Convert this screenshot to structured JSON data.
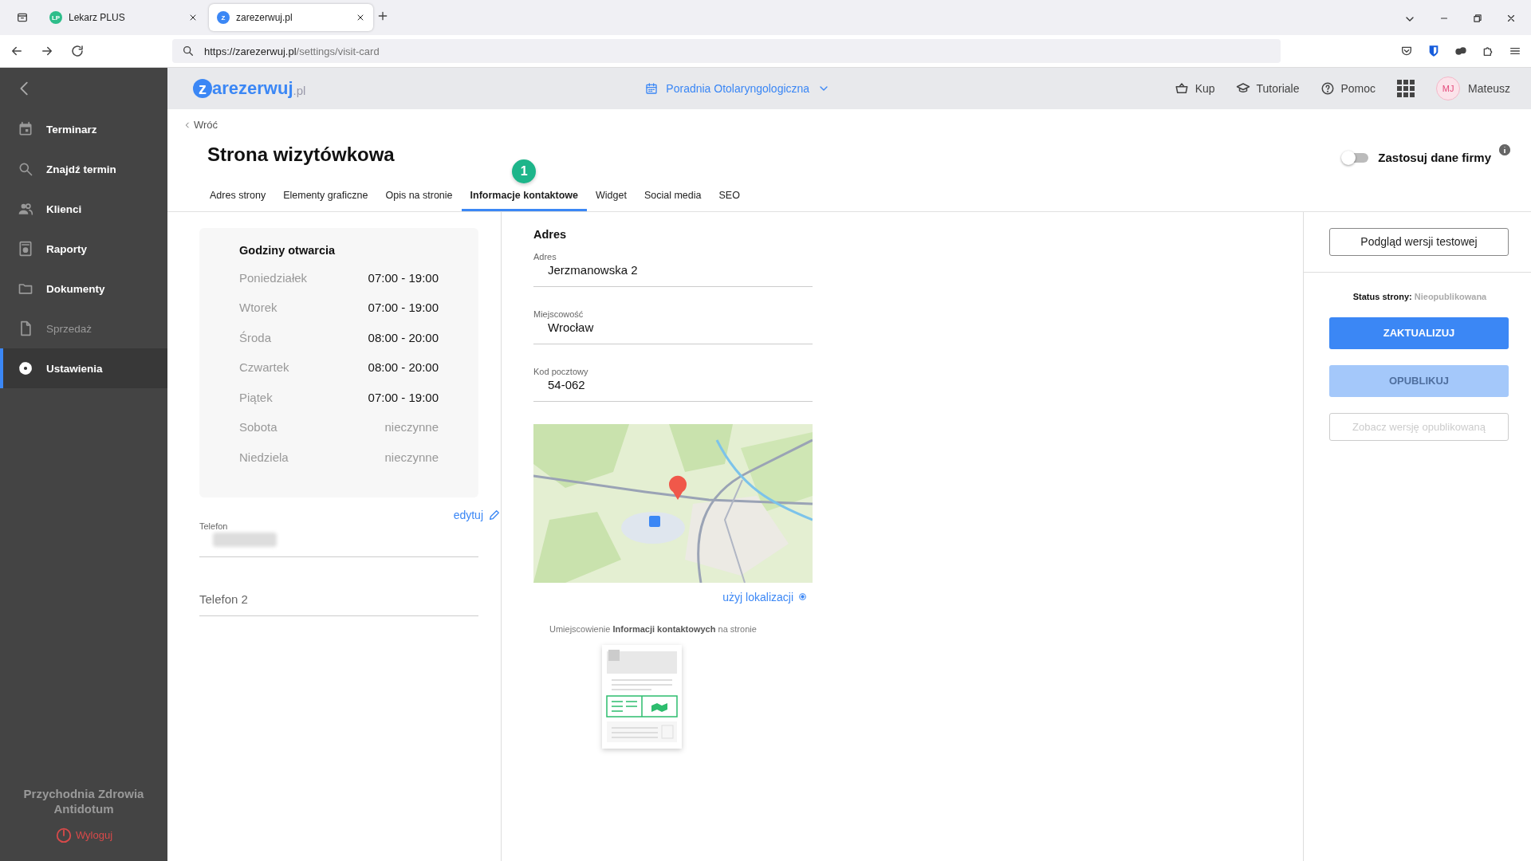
{
  "browser": {
    "tabs": [
      {
        "icon": "LP",
        "title": "Lekarz PLUS",
        "selected": false
      },
      {
        "icon": "Z",
        "title": "zarezerwuj.pl",
        "selected": true
      }
    ],
    "url_host": "https://zarezerwuj.pl",
    "url_path": "/settings/visit-card"
  },
  "header": {
    "logo": {
      "mark": "z",
      "name": "arezerwuj",
      "suffix": ".pl"
    },
    "clinic": "Poradnia Otolaryngologiczna",
    "links": [
      {
        "kind": "basket",
        "label": "Kup"
      },
      {
        "kind": "cap",
        "label": "Tutoriale"
      },
      {
        "kind": "help",
        "label": "Pomoc"
      }
    ],
    "user": {
      "initials": "MJ",
      "name": "Mateusz"
    }
  },
  "sidebar": {
    "items": [
      {
        "kind": "calendar",
        "label": "Terminarz",
        "selected": false,
        "disabled": false
      },
      {
        "kind": "search",
        "label": "Znajdź termin",
        "selected": false,
        "disabled": false
      },
      {
        "kind": "people",
        "label": "Klienci",
        "selected": false,
        "disabled": false
      },
      {
        "kind": "report",
        "label": "Raporty",
        "selected": false,
        "disabled": false
      },
      {
        "kind": "folder",
        "label": "Dokumenty",
        "selected": false,
        "disabled": false
      },
      {
        "kind": "file",
        "label": "Sprzedaż",
        "selected": false,
        "disabled": true
      },
      {
        "kind": "gear",
        "label": "Ustawienia",
        "selected": true,
        "disabled": false
      }
    ],
    "company": "Przychodnia Zdrowia Antidotum",
    "logout": "Wyloguj"
  },
  "page": {
    "back": "Wróć",
    "title": "Strona wizytówkowa",
    "toggle": {
      "label": "Zastosuj dane firmy",
      "on": false
    },
    "tabs": [
      {
        "label": "Adres strony",
        "selected": false
      },
      {
        "label": "Elementy graficzne",
        "selected": false
      },
      {
        "label": "Opis na stronie",
        "selected": false
      },
      {
        "label": "Informacje kontaktowe",
        "selected": true,
        "badge": "1"
      },
      {
        "label": "Widget",
        "selected": false
      },
      {
        "label": "Social media",
        "selected": false
      },
      {
        "label": "SEO",
        "selected": false
      }
    ]
  },
  "hours": {
    "title": "Godziny otwarcia",
    "rows": [
      {
        "day": "Poniedziałek",
        "hours": "07:00 - 19:00",
        "closed": false
      },
      {
        "day": "Wtorek",
        "hours": "07:00 - 19:00",
        "closed": false
      },
      {
        "day": "Środa",
        "hours": "08:00 - 20:00",
        "closed": false
      },
      {
        "day": "Czwartek",
        "hours": "08:00 - 20:00",
        "closed": false
      },
      {
        "day": "Piątek",
        "hours": "07:00 - 19:00",
        "closed": false
      },
      {
        "day": "Sobota",
        "hours": "nieczynne",
        "closed": true
      },
      {
        "day": "Niedziela",
        "hours": "nieczynne",
        "closed": true
      }
    ],
    "edit": "edytuj"
  },
  "phones": {
    "phone_label": "Telefon",
    "phone2_placeholder": "Telefon 2"
  },
  "address": {
    "title": "Adres",
    "fields": [
      {
        "label": "Adres",
        "value": "Jerzmanowska 2"
      },
      {
        "label": "Miejscowość",
        "value": "Wrocław"
      },
      {
        "label": "Kod pocztowy",
        "value": "54-062"
      }
    ],
    "use_location": "użyj lokalizacji",
    "placement_note": "Umiejscowienie **Informacji kontaktowych** na stronie"
  },
  "actions": {
    "preview": "Podgląd wersji testowej",
    "status_label": "Status strony:",
    "status_value": "Nieopublikowana",
    "buttons": [
      {
        "kind": "primary",
        "label": "ZAKTUALIZUJ",
        "disabled": false
      },
      {
        "kind": "primary",
        "label": "OPUBLIKUJ",
        "disabled": true
      },
      {
        "kind": "outline",
        "label": "Zobacz wersję opublikowaną",
        "disabled": true
      }
    ]
  }
}
